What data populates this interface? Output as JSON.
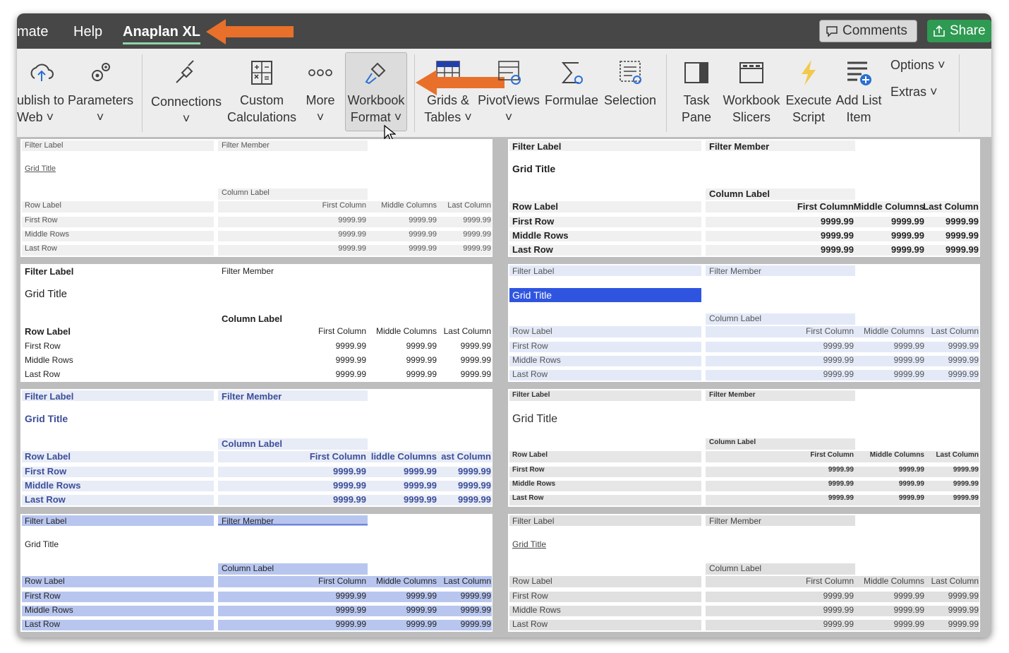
{
  "menubar": {
    "items": [
      "mate",
      "Help",
      "Anaplan XL"
    ],
    "comments": "Comments",
    "share": "Share"
  },
  "ribbon": {
    "publish": [
      "ublish to",
      "Web ˅"
    ],
    "parameters": [
      "Parameters",
      "˅"
    ],
    "connections": [
      "Connections",
      "˅"
    ],
    "custom": [
      "Custom",
      "Calculations"
    ],
    "more": [
      "More",
      "˅"
    ],
    "workbook_format": [
      "Workbook",
      "Format ˅"
    ],
    "grids": [
      "Grids &",
      "Tables ˅"
    ],
    "pivotviews": [
      "PivotViews",
      "˅"
    ],
    "formulae": [
      "Formulae"
    ],
    "selection": [
      "Selection"
    ],
    "task_pane": [
      "Task",
      "Pane"
    ],
    "slicers": [
      "Workbook",
      "Slicers"
    ],
    "execute": [
      "Execute",
      "Script"
    ],
    "addlist": [
      "Add List",
      "Item"
    ],
    "options": "Options ˅",
    "extras": "Extras ˅"
  },
  "grid": {
    "filter_label": "Filter Label",
    "filter_member": "Filter Member",
    "grid_title": "Grid Title",
    "column_label": "Column Label",
    "row_label": "Row Label",
    "cols": [
      "First Column",
      "Middle Columns",
      "Last Column"
    ],
    "cols_trunc": [
      "First Column",
      "liddle Columns",
      "ast Column"
    ],
    "rows": [
      "First Row",
      "Middle Rows",
      "Last Row"
    ],
    "value": "9999.99"
  },
  "colors": {
    "menubar": "#474747",
    "accent_green": "#2e9a52",
    "arrow": "#e8702a",
    "ribbon": "#ededed",
    "select_blue": "#2f55e0",
    "nav_blue": "#3c4e9a"
  }
}
